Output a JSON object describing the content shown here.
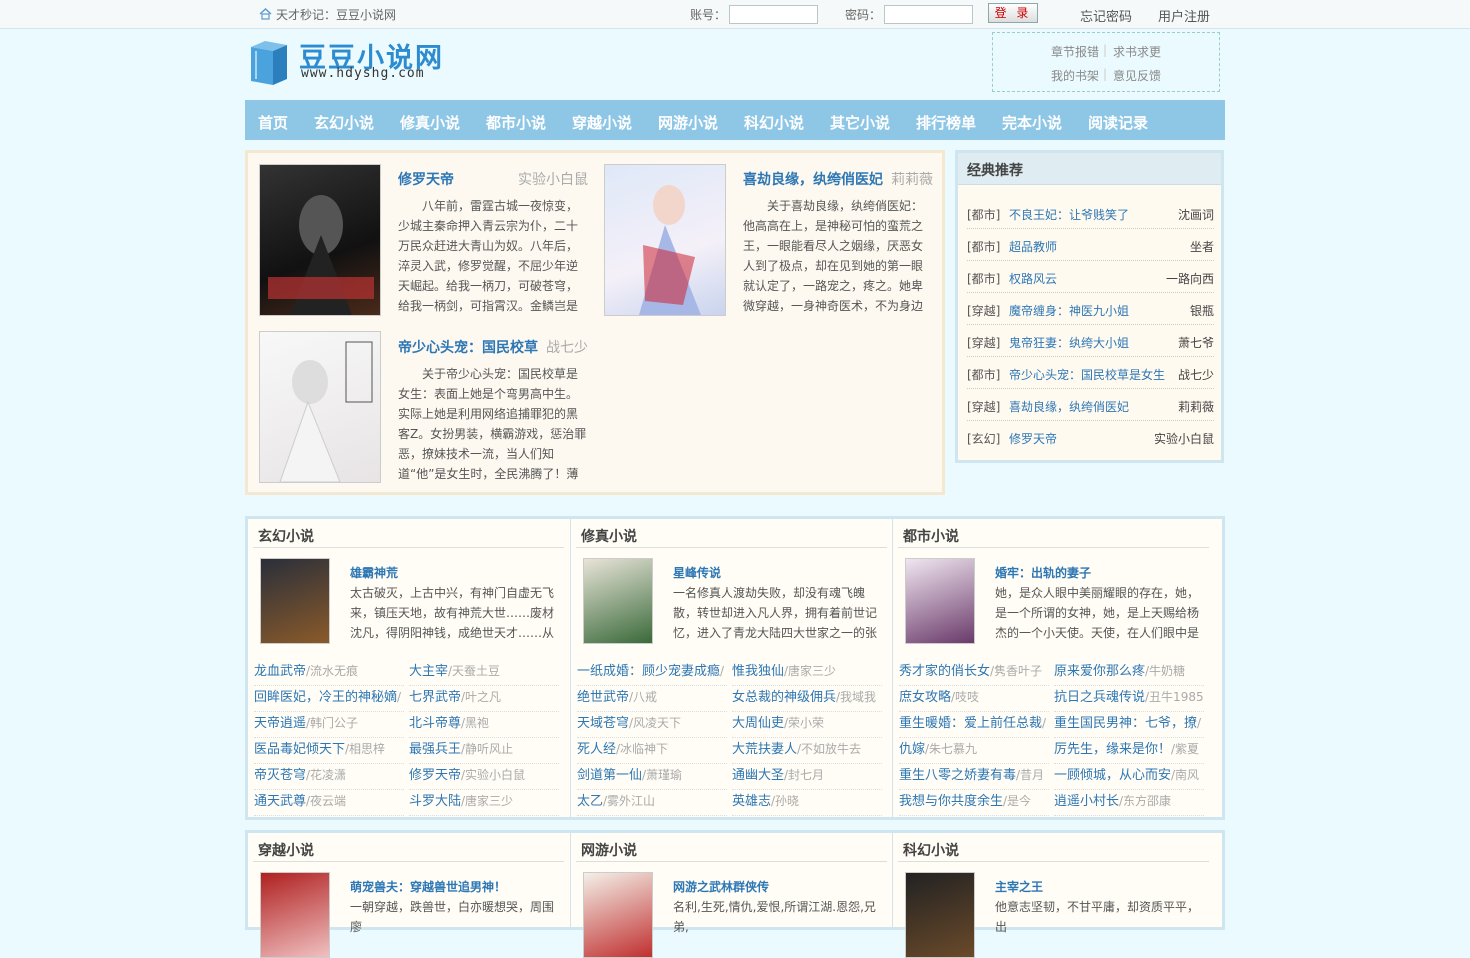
{
  "topbar": {
    "slogan": "天才秒记：豆豆小说网",
    "account_label": "账号：",
    "password_label": "密码：",
    "login_button": "登 录",
    "forgot": "忘记密码",
    "register": "用户注册"
  },
  "logo": {
    "title": "豆豆小说网",
    "url": "www.hdyshg.com"
  },
  "quicklinks": {
    "error": "章节报错",
    "request": "求书求更",
    "shelf": "我的书架",
    "feedback": "意见反馈",
    "separator": "|"
  },
  "nav": [
    "首页",
    "玄幻小说",
    "修真小说",
    "都市小说",
    "穿越小说",
    "网游小说",
    "科幻小说",
    "其它小说",
    "排行榜单",
    "完本小说",
    "阅读记录"
  ],
  "featured": [
    {
      "title": "修罗天帝",
      "author": "实验小白鼠",
      "desc": "八年前，雷霆古城一夜惊变，少城主秦命押入青云宗为仆，二十万民众赶进大青山为奴。八年后，淬灵入武，修罗觉醒，不屈少年逆天崛起。给我一柄刀，可破苍穹，给我一柄剑，可指霄汉。金鳞岂是"
    },
    {
      "title": "喜劫良缘，纨绔俏医妃",
      "author": "莉莉薇",
      "desc": "关于喜劫良缘，纨绔俏医妃：他高高在上，是神秘可怕的蛮荒之王，一眼能看尽人之姻缘，厌恶女人到了极点，却在见到她的第一眼就认定了，一路宠之，疼之。她卑微穿越，一身神奇医术，不为身边"
    },
    {
      "title": "帝少心头宠：国民校草",
      "author": "战七少",
      "desc": "关于帝少心头宠：国民校草是女生：表面上她是个弯男高中生。实际上她是利用网络追捕罪犯的黑客Z。女扮男装，横霸游戏，惩治罪恶，撩妹技术一流，当人们知道“他”是女生时，全民沸腾了！薄"
    }
  ],
  "recommend": {
    "heading": "经典推荐",
    "items": [
      {
        "cat": "[都市]",
        "name": "不良王妃：让爷贱笑了",
        "author": "沈画词"
      },
      {
        "cat": "[都市]",
        "name": "超品教师",
        "author": "坐者"
      },
      {
        "cat": "[都市]",
        "name": "权路风云",
        "author": "一路向西"
      },
      {
        "cat": "[穿越]",
        "name": "魔帝缠身：神医九小姐",
        "author": "银瓶"
      },
      {
        "cat": "[穿越]",
        "name": "鬼帝狂妻：纨绔大小姐",
        "author": "萧七爷"
      },
      {
        "cat": "[都市]",
        "name": "帝少心头宠：国民校草是女生",
        "author": "战七少"
      },
      {
        "cat": "[穿越]",
        "name": "喜劫良缘，纨绔俏医妃",
        "author": "莉莉薇"
      },
      {
        "cat": "[玄幻]",
        "name": "修罗天帝",
        "author": "实验小白鼠"
      }
    ]
  },
  "sections1": [
    {
      "heading": "玄幻小说",
      "top_title": "雄霸神荒",
      "top_desc": "太古破灭，上古中兴，有神门自虚无飞来，镇压天地，故有神荒大世……废材沈凡，得阴阳神钱，成绝世天才……从此，",
      "list": [
        {
          "n": "龙血武帝",
          "a": "/流水无痕"
        },
        {
          "n": "大主宰",
          "a": "/天蚕土豆"
        },
        {
          "n": "回眸医妃，冷王的神秘嫡",
          "a": "/"
        },
        {
          "n": "七界武帝",
          "a": "/叶之凡"
        },
        {
          "n": "天帝逍遥",
          "a": "/韩门公子"
        },
        {
          "n": "北斗帝尊",
          "a": "/黑袍"
        },
        {
          "n": "医品毒妃倾天下",
          "a": "/相思梓"
        },
        {
          "n": "最强兵王",
          "a": "/静听风止"
        },
        {
          "n": "帝灭苍穹",
          "a": "/花凌潇"
        },
        {
          "n": "修罗天帝",
          "a": "/实验小白鼠"
        },
        {
          "n": "通天武尊",
          "a": "/夜云端"
        },
        {
          "n": "斗罗大陆",
          "a": "/唐家三少"
        }
      ]
    },
    {
      "heading": "修真小说",
      "top_title": "星峰传说",
      "top_desc": "一名修真人渡劫失败，却没有魂飞魄散，转世却进入凡人界，拥有着前世记忆，进入了青龙大陆四大世家之一的张氏世家，",
      "list": [
        {
          "n": "一纸成婚：顾少宠妻成瘾",
          "a": "/"
        },
        {
          "n": "惟我独仙",
          "a": "/唐家三少"
        },
        {
          "n": "绝世武帝",
          "a": "/八戒"
        },
        {
          "n": "女总裁的神级佣兵",
          "a": "/我域我"
        },
        {
          "n": "天域苍穹",
          "a": "/风凌天下"
        },
        {
          "n": "大周仙吏",
          "a": "/荣小荣"
        },
        {
          "n": "死人经",
          "a": "/冰临神下"
        },
        {
          "n": "大荒扶妻人",
          "a": "/不如放牛去"
        },
        {
          "n": "剑道第一仙",
          "a": "/萧瑾瑜"
        },
        {
          "n": "通幽大圣",
          "a": "/封七月"
        },
        {
          "n": "太乙",
          "a": "/雾外江山"
        },
        {
          "n": "英雄志",
          "a": "/孙晓"
        }
      ]
    },
    {
      "heading": "都市小说",
      "top_title": "婚牢：出轨的妻子",
      "top_desc": "她，是众人眼中美丽耀眼的存在，她，是一个所谓的女神，她，是上天赐给杨杰的一个小天使。天使，在人们眼中是象征圣",
      "list": [
        {
          "n": "秀才家的俏长女",
          "a": "/隽香叶子"
        },
        {
          "n": "原来爱你那么疼",
          "a": "/牛奶糖"
        },
        {
          "n": "庶女攻略",
          "a": "/吱吱"
        },
        {
          "n": "抗日之兵魂传说",
          "a": "/丑牛1985"
        },
        {
          "n": "重生暖婚：爱上前任总裁",
          "a": "/"
        },
        {
          "n": "重生国民男神：七爷，撩",
          "a": "/"
        },
        {
          "n": "仇嫁",
          "a": "/朱七慕九"
        },
        {
          "n": "厉先生，缘来是你！",
          "a": "/紫夏"
        },
        {
          "n": "重生八零之娇妻有毒",
          "a": "/昔月"
        },
        {
          "n": "一顾倾城，从心而安",
          "a": "/南风"
        },
        {
          "n": "我想与你共度余生",
          "a": "/是今"
        },
        {
          "n": "逍遥小村长",
          "a": "/东方邵康"
        }
      ]
    }
  ],
  "sections2": [
    {
      "heading": "穿越小说",
      "top_title": "萌宠兽夫：穿越兽世追男神！",
      "top_desc": "一朝穿越，跌兽世，白亦暖想哭，周围廖"
    },
    {
      "heading": "网游小说",
      "top_title": "网游之武林群侠传",
      "top_desc": "名利,生死,情仇,爱恨,所谓江湖.恩怨,兄弟,"
    },
    {
      "heading": "科幻小说",
      "top_title": "主宰之王",
      "top_desc": "他意志坚韧，不甘平庸，却资质平平，出"
    }
  ]
}
